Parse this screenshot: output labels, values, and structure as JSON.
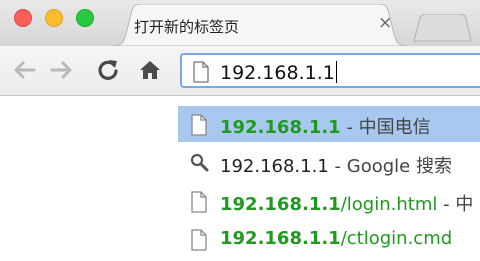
{
  "tab": {
    "title": "打开新的标签页",
    "close_label": "×"
  },
  "omnibox": {
    "value": "192.168.1.1"
  },
  "suggestions": [
    {
      "url": "192.168.1.1",
      "sep": " - ",
      "desc": "中国电信"
    },
    {
      "text": "192.168.1.1",
      "sep": " - ",
      "desc": "Google 搜索"
    },
    {
      "host": "192.168.1.1",
      "path": "/login.html",
      "sep": " - ",
      "desc": "中"
    },
    {
      "host": "192.168.1.1",
      "path": "/ctlogin.cmd"
    }
  ],
  "colors": {
    "url_green": "#1f9a1f",
    "selection": "#a9c8ef",
    "focus_ring": "#7aa7e6"
  },
  "icons": {
    "page": "page-icon",
    "search": "search-icon",
    "back": "back-arrow-icon",
    "forward": "forward-arrow-icon",
    "reload": "reload-icon",
    "home": "home-icon"
  }
}
